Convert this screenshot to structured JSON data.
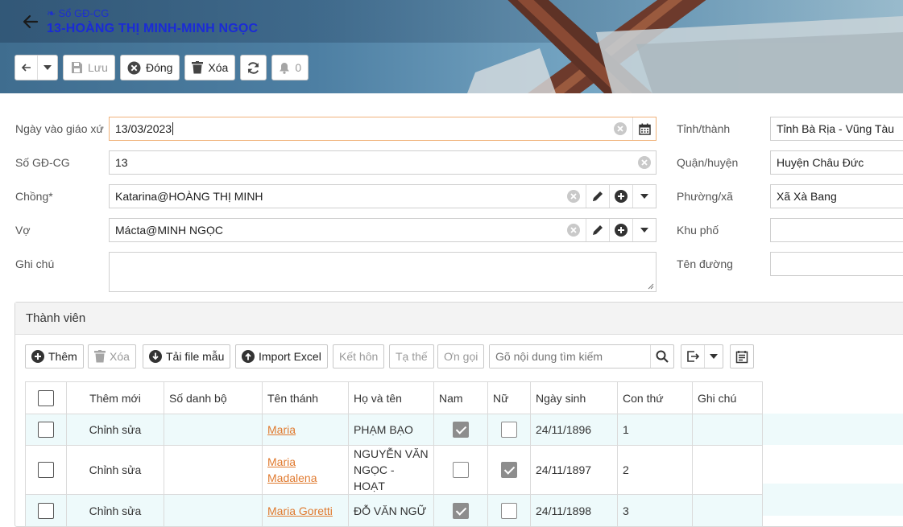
{
  "header": {
    "breadcrumb": "❧ Sổ GĐ-CG",
    "title": "13-HOÀNG THỊ MINH-MINH NGỌC"
  },
  "toolbar": {
    "save_label": "Lưu",
    "close_label": "Đóng",
    "delete_label": "Xóa",
    "notification_count": "0"
  },
  "form": {
    "date_label": "Ngày vào giáo xứ",
    "date_value": "13/03/2023",
    "number_label": "Số GĐ-CG",
    "number_value": "13",
    "husband_label": "Chồng*",
    "husband_value": "Katarina@HOÀNG THỊ MINH",
    "wife_label": "Vợ",
    "wife_value": "Mácta@MINH NGỌC",
    "note_label": "Ghi chú",
    "note_value": "",
    "province_label": "Tỉnh/thành",
    "province_value": "Tỉnh Bà Rịa - Vũng Tàu",
    "district_label": "Quận/huyện",
    "district_value": "Huyện Châu Đức",
    "ward_label": "Phường/xã",
    "ward_value": "Xã Xà Bang",
    "quarter_label": "Khu phố",
    "quarter_value": "",
    "street_label": "Tên đường",
    "street_value": ""
  },
  "members": {
    "title": "Thành viên",
    "add_label": "Thêm",
    "delete_label": "Xóa",
    "template_label": "Tải file mẫu",
    "import_label": "Import Excel",
    "marriage_label": "Kết hôn",
    "death_label": "Tạ thế",
    "vocation_label": "Ơn gọi",
    "search_placeholder": "Gõ nội dung tìm kiếm",
    "columns": [
      "Thêm mới",
      "Số danh bộ",
      "Tên thánh",
      "Họ và tên",
      "Nam",
      "Nữ",
      "Ngày sinh",
      "Con thứ",
      "Ghi chú"
    ],
    "rows": [
      {
        "action": "Chỉnh sửa",
        "registry": "",
        "saint_name": "Maria",
        "full_name": "PHẠM BẠO",
        "male": true,
        "female": false,
        "birth_date": "24/11/1896",
        "child_order": "1",
        "note": ""
      },
      {
        "action": "Chỉnh sửa",
        "registry": "",
        "saint_name": "Maria Madalena",
        "full_name": "NGUYỄN VĂN NGỌC - HOẠT",
        "male": false,
        "female": true,
        "birth_date": "24/11/1897",
        "child_order": "2",
        "note": ""
      },
      {
        "action": "Chỉnh sửa",
        "registry": "",
        "saint_name": "Maria Goretti",
        "full_name": "ĐỖ VĂN NGỮ",
        "male": true,
        "female": false,
        "birth_date": "24/11/1898",
        "child_order": "3",
        "note": ""
      }
    ]
  }
}
